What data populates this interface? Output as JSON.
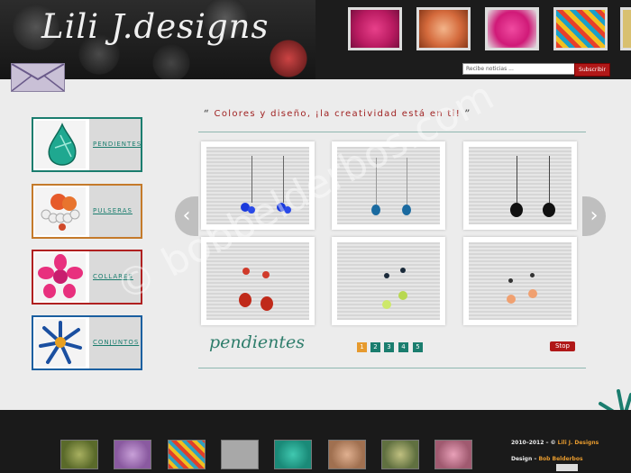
{
  "header": {
    "logo": "Lili J.designs",
    "newsletter_placeholder": "Recibe noticias ...",
    "subscribe_label": "Subscribir"
  },
  "sidebar": {
    "items": [
      {
        "label": "PENDIENTES",
        "color": "#1a7d6e"
      },
      {
        "label": "PULSERAS",
        "color": "#c47a2a"
      },
      {
        "label": "COLLARES",
        "color": "#b02020"
      },
      {
        "label": "CONJUNTOS",
        "color": "#1a5fa0"
      }
    ]
  },
  "main": {
    "tagline": "Colores y diseño, ¡la creatividad está en ti!",
    "gallery_title": "pendientes",
    "pages": [
      "1",
      "2",
      "3",
      "4",
      "5"
    ],
    "stop_label": "Stop"
  },
  "watermark": "© bobbelderbos.com",
  "footer": {
    "copyright_prefix": "2010–2012 – ©",
    "copyright_brand": "Lili J. Designs",
    "design_prefix": "Design –",
    "designer": "Bob Belderbos"
  }
}
